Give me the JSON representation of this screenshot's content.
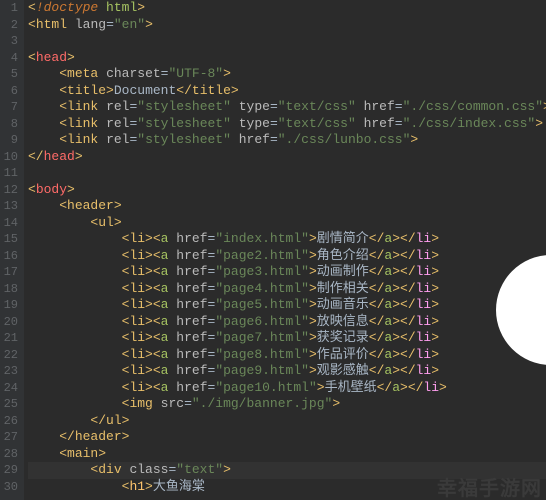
{
  "watermark": "幸福手游网",
  "doc": {
    "doctype": "!doctype",
    "doctype_arg": "html",
    "html_tag": "html",
    "lang_attr": "lang",
    "lang_val": "\"en\"",
    "head_tag": "head",
    "meta_tag": "meta",
    "charset_attr": "charset",
    "charset_val": "\"UTF-8\"",
    "title_tag": "title",
    "title_text": "Document",
    "link_tag": "link",
    "rel_attr": "rel",
    "rel_val": "\"stylesheet\"",
    "type_attr": "type",
    "type_val": "\"text/css\"",
    "href_attr": "href",
    "link1_href": "\"./css/common.css\"",
    "link2_href": "\"./css/index.css\"",
    "link3_href": "\"./css/lunbo.css\"",
    "body_tag": "body",
    "header_tag": "header",
    "ul_tag": "ul",
    "li_tag": "li",
    "a_tag": "a",
    "img_tag": "img",
    "src_attr": "src",
    "img_src": "\"./img/banner.jpg\"",
    "main_tag": "main",
    "div_tag": "div",
    "class_attr": "class",
    "div_class_val": "\"text\"",
    "h1_tag": "h1",
    "h1_text": "大鱼海棠"
  },
  "items": [
    {
      "href": "\"index.html\"",
      "text": "剧情简介"
    },
    {
      "href": "\"page2.html\"",
      "text": "角色介绍"
    },
    {
      "href": "\"page3.html\"",
      "text": "动画制作"
    },
    {
      "href": "\"page4.html\"",
      "text": "制作相关"
    },
    {
      "href": "\"page5.html\"",
      "text": "动画音乐"
    },
    {
      "href": "\"page6.html\"",
      "text": "放映信息"
    },
    {
      "href": "\"page7.html\"",
      "text": "获奖记录"
    },
    {
      "href": "\"page8.html\"",
      "text": "作品评价"
    },
    {
      "href": "\"page9.html\"",
      "text": "观影感触"
    },
    {
      "href": "\"page10.html\"",
      "text": "手机壁纸"
    }
  ],
  "line_numbers": [
    "1",
    "2",
    "3",
    "4",
    "5",
    "6",
    "7",
    "8",
    "9",
    "10",
    "11",
    "12",
    "13",
    "14",
    "15",
    "16",
    "17",
    "18",
    "19",
    "20",
    "21",
    "22",
    "23",
    "24",
    "25",
    "26",
    "27",
    "28",
    "29",
    "30"
  ]
}
